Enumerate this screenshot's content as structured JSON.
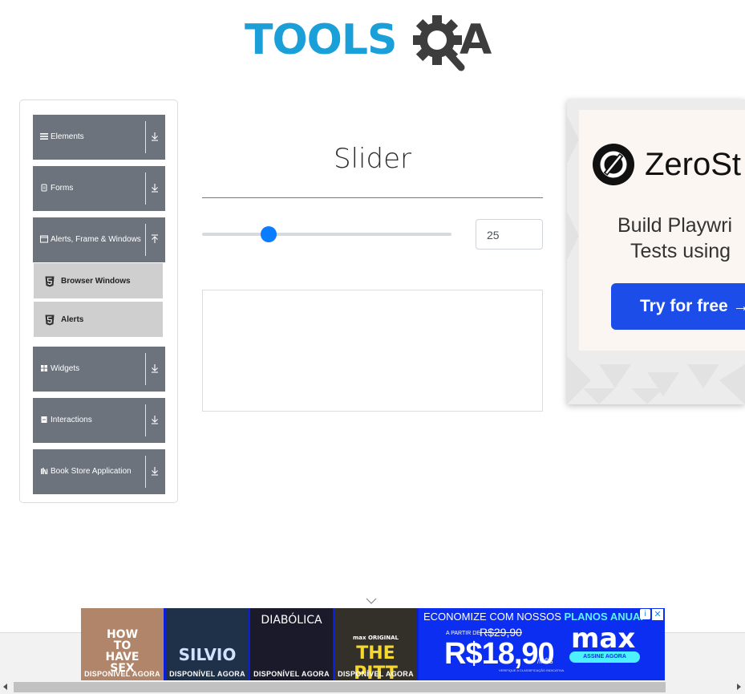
{
  "logo": {
    "text": "TOOLS",
    "suffix": "A"
  },
  "sidebar": {
    "groups": [
      {
        "label": "Elements",
        "icon": "hamburger-icon",
        "expanded": false
      },
      {
        "label": "Forms",
        "icon": "document-icon",
        "expanded": false
      },
      {
        "label": "Alerts, Frame & Windows",
        "icon": "window-icon",
        "expanded": true,
        "items": [
          {
            "label": "Browser Windows",
            "icon": "html5-icon"
          },
          {
            "label": "Alerts",
            "icon": "html5-icon"
          }
        ]
      },
      {
        "label": "Widgets",
        "icon": "grid-icon",
        "expanded": false
      },
      {
        "label": "Interactions",
        "icon": "box-icon",
        "expanded": false
      },
      {
        "label": "Book Store Application",
        "icon": "books-icon",
        "expanded": false
      }
    ]
  },
  "main": {
    "title": "Slider",
    "slider": {
      "value": "25",
      "min": 0,
      "max": 100
    }
  },
  "side_ad": {
    "brand": "ZeroSt",
    "headline_line1": "Build Playwri",
    "headline_line2": "Tests using",
    "cta": "Try for free →"
  },
  "bottom_ad": {
    "tiles": [
      {
        "title": "HOW TO HAVE SEX",
        "footer": "DISPONÍVEL AGORA",
        "color": "#b0856a"
      },
      {
        "title": "SILVIO",
        "footer": "DISPONÍVEL AGORA",
        "color": "#1f3049"
      },
      {
        "title": "DIABÓLICA",
        "footer": "DISPONÍVEL AGORA",
        "color": "#1a1a2a"
      },
      {
        "title": "THE PITT",
        "footer": "DISPONÍVEL AGORA",
        "color": "#33302a",
        "badge": "max ORIGINAL"
      }
    ],
    "promo": {
      "top_plain": "ECONOMIZE COM NOSSOS ",
      "top_highlight": "PLANOS ANUAI",
      "from": "A PARTIR DE",
      "old_price": "R$29,90",
      "price": "R$18,90",
      "per": "/MÊS",
      "brand": "max",
      "button": "ASSINE AGORA",
      "note": "VERIFIQUE A CLASSIFICAÇÃO INDICATIVA."
    },
    "info": "i",
    "close": "✕"
  },
  "colors": {
    "accent": "#0a7cff",
    "sidebar_group": "#6c737d",
    "sidebar_item": "#cfcfcf",
    "logo_blue": "#1b9fd8"
  }
}
